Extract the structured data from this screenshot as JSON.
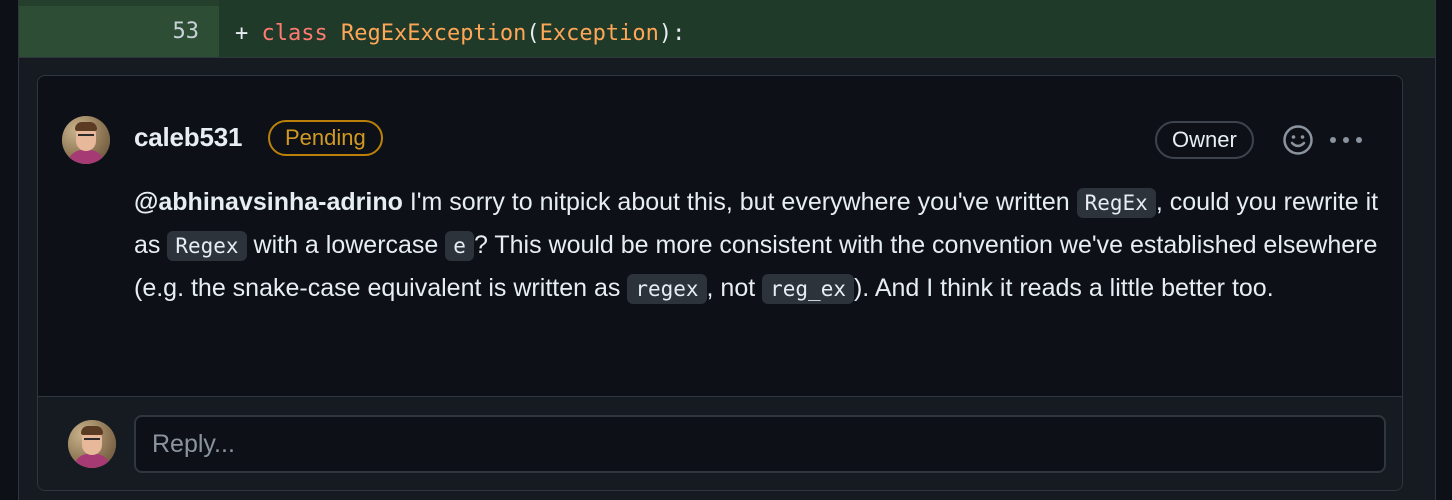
{
  "diff": {
    "line_number": "53",
    "prefix": "+",
    "keyword": "class",
    "class_name": "RegExException",
    "open_paren": "(",
    "base_class": "Exception",
    "close": "):"
  },
  "comment": {
    "username": "caleb531",
    "status_badge": "Pending",
    "role_badge": "Owner",
    "mention": "@abhinavsinha-adrino",
    "segments": [
      " I'm sorry to nitpick about this, but everywhere you've written ",
      ", could you rewrite it as ",
      " with a lowercase ",
      "? This would be more consistent with the convention we've established elsewhere (e.g. the snake-case equivalent is written as ",
      ", not ",
      "). And I think it reads a little better too."
    ],
    "codes": [
      "RegEx",
      "Regex",
      "e",
      "regex",
      "reg_ex"
    ]
  },
  "reply": {
    "placeholder": "Reply..."
  },
  "icons": {
    "reaction": "smiley-icon",
    "more": "kebab-horizontal-icon"
  },
  "colors": {
    "added_line_bg": "#1f3a28",
    "pending": "#d29922",
    "keyword": "#ff7b72",
    "class_name": "#ffa657"
  }
}
